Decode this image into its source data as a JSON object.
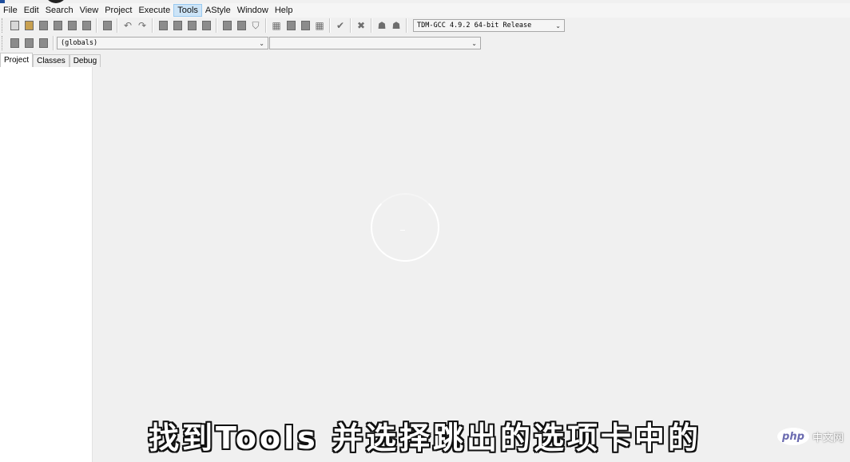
{
  "menubar": {
    "items": [
      "File",
      "Edit",
      "Search",
      "View",
      "Project",
      "Execute",
      "Tools",
      "AStyle",
      "Window",
      "Help"
    ],
    "active": "Tools"
  },
  "toolbar": {
    "compiler_select": "TDM-GCC 4.9.2 64-bit Release",
    "globals_select": "(globals)",
    "members_select": ""
  },
  "left_tabs": [
    "Project",
    "Classes",
    "Debug"
  ],
  "subtitle": "找到Tools 并选择跳出的选项卡中的",
  "watermark": {
    "logo": "php",
    "text": "中文网"
  },
  "icons": {
    "row1": [
      "new-file-icon",
      "open-project-icon",
      "save-icon",
      "save-all-icon",
      "close-icon",
      "close-all-icon",
      "print-icon",
      "undo-icon",
      "redo-icon",
      "find-icon",
      "replace-icon",
      "find-next-icon",
      "goto-line-icon",
      "indent-icon",
      "unindent-icon",
      "toggle-comment-icon",
      "compile-icon",
      "run-icon",
      "compile-run-icon",
      "rebuild-icon",
      "check-icon",
      "stop-icon",
      "debug-icon",
      "profile-icon"
    ],
    "row2": [
      "new-class-icon",
      "goto-declaration-icon",
      "goto-definition-icon"
    ]
  },
  "colors": {
    "menu_highlight": "#cce4f7",
    "background": "#f0f0f0"
  }
}
